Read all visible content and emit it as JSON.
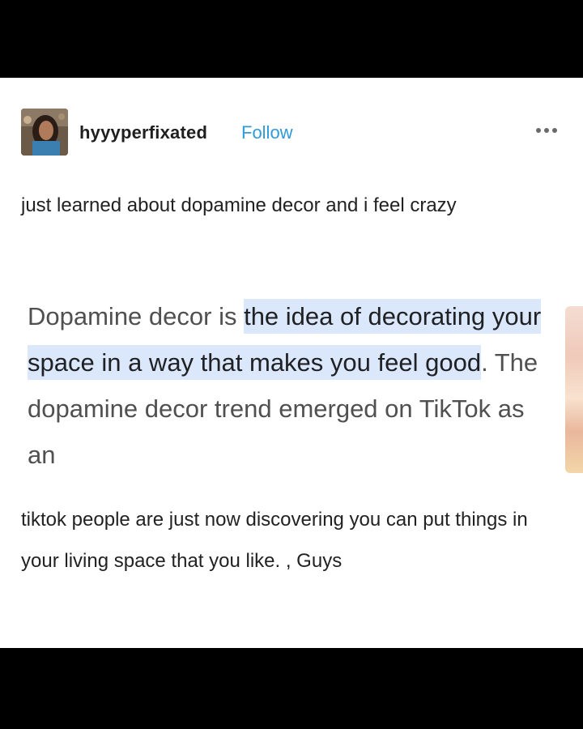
{
  "post": {
    "author": {
      "username": "hyyyperfixated",
      "follow_label": "Follow"
    },
    "more_icon": "more-dots-icon",
    "intro_text": "just learned about dopamine decor and i feel crazy",
    "quote": {
      "before": "Dopamine decor is ",
      "highlight": "the idea of decorating your space in a way that makes you feel good",
      "after": ". The dopamine decor trend emerged on TikTok as an"
    },
    "outro_text": "tiktok people are just now discovering you can put things in your living space that you like. , Guys"
  },
  "colors": {
    "follow": "#2e9ad8",
    "highlight": "#dbe8fb",
    "background": "#000000",
    "card": "#ffffff"
  }
}
